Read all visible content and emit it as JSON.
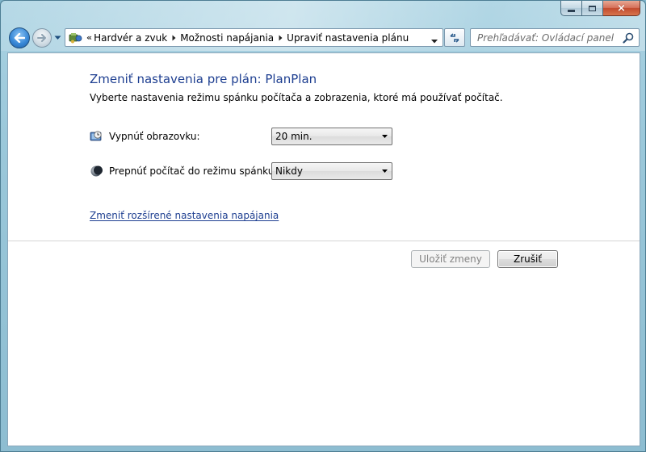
{
  "window": {
    "caption_buttons": {
      "minimize": "minimize",
      "maximize": "maximize",
      "close": "×"
    }
  },
  "nav": {
    "breadcrumbs_overflow": "«",
    "breadcrumbs": [
      "Hardvér a zvuk",
      "Možnosti napájania",
      "Upraviť nastavenia plánu"
    ],
    "search_placeholder": "Prehľadávať: Ovládací panel"
  },
  "main": {
    "title": "Zmeniť nastavenia pre plán: PlanPlan",
    "description": "Vyberte nastavenia režimu spánku počítača a zobrazenia, ktoré má používať počítač.",
    "settings": [
      {
        "label": "Vypnúť obrazovku:",
        "value": "20 min.",
        "icon": "display-clock-icon"
      },
      {
        "label": "Prepnúť počítač do režimu spánku:",
        "value": "Nikdy",
        "icon": "moon-sleep-icon"
      }
    ],
    "advanced_link": "Zmeniť rozšírené nastavenia napájania",
    "buttons": {
      "save": "Uložiť zmeny",
      "cancel": "Zrušiť"
    }
  },
  "colors": {
    "heading": "#1e3f91",
    "link": "#1e3f91",
    "close_button": "#c24a2e"
  }
}
